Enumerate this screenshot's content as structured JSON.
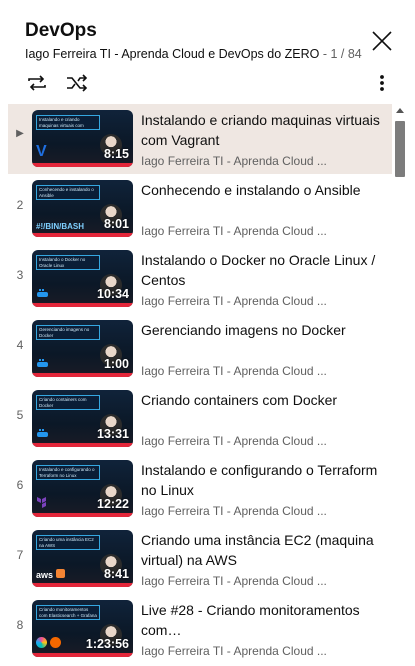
{
  "header": {
    "title": "DevOps",
    "channel": "Iago Ferreira TI - Aprenda Cloud e DevOps do ZERO",
    "counter": "1 / 84"
  },
  "icons": {
    "close": "close-icon",
    "loop": "loop-icon",
    "shuffle": "shuffle-icon",
    "more": "more-vert-icon"
  },
  "colors": {
    "active_row": "#efe7e2",
    "progress_red": "#e3263a",
    "secondary_text": "#606060"
  },
  "playlist": [
    {
      "index": "▶",
      "title": "Instalando e criando maquinas virtuais com Vagrant",
      "channel": "Iago Ferreira TI - Aprenda Cloud ...",
      "duration": "8:15",
      "thumb_text": "Instalando e criando maquinas virtuais com Vagrant",
      "thumb_logo": "V"
    },
    {
      "index": "2",
      "title": "Conhecendo e instalando o Ansible",
      "channel": "Iago Ferreira TI - Aprenda Cloud ...",
      "duration": "8:01",
      "thumb_text": "Conhecendo e instalando o Ansible",
      "thumb_logo": "#!/BIN/BASH"
    },
    {
      "index": "3",
      "title": "Instalando o Docker no Oracle Linux / Centos",
      "channel": "Iago Ferreira TI - Aprenda Cloud ...",
      "duration": "10:34",
      "thumb_text": "Instalando o Docker no Oracle Linux",
      "thumb_logo": "docker"
    },
    {
      "index": "4",
      "title": "Gerenciando imagens no Docker",
      "channel": "Iago Ferreira TI - Aprenda Cloud ...",
      "duration": "1:00",
      "thumb_text": "Gerenciando imagens no Docker",
      "thumb_logo": "docker"
    },
    {
      "index": "5",
      "title": "Criando containers com Docker",
      "channel": "Iago Ferreira TI - Aprenda Cloud ...",
      "duration": "13:31",
      "thumb_text": "Criando containers com Docker",
      "thumb_logo": "docker"
    },
    {
      "index": "6",
      "title": "Instalando e configurando o Terraform no Linux",
      "channel": "Iago Ferreira TI - Aprenda Cloud ...",
      "duration": "12:22",
      "thumb_text": "Instalando e configurando o Terraform no Linux",
      "thumb_logo": "terraform"
    },
    {
      "index": "7",
      "title": "Criando uma instância EC2 (maquina virtual) na AWS",
      "channel": "Iago Ferreira TI - Aprenda Cloud ...",
      "duration": "8:41",
      "thumb_text": "Criando uma instância EC2 na AWS",
      "thumb_logo": "aws"
    },
    {
      "index": "8",
      "title": "Live #28 - Criando monitoramentos com…",
      "channel": "Iago Ferreira TI - Aprenda Cloud ...",
      "duration": "1:23:56",
      "thumb_text": "Criando monitoramentos com Elasticsearch + Grafana",
      "thumb_logo": "grafana"
    }
  ]
}
